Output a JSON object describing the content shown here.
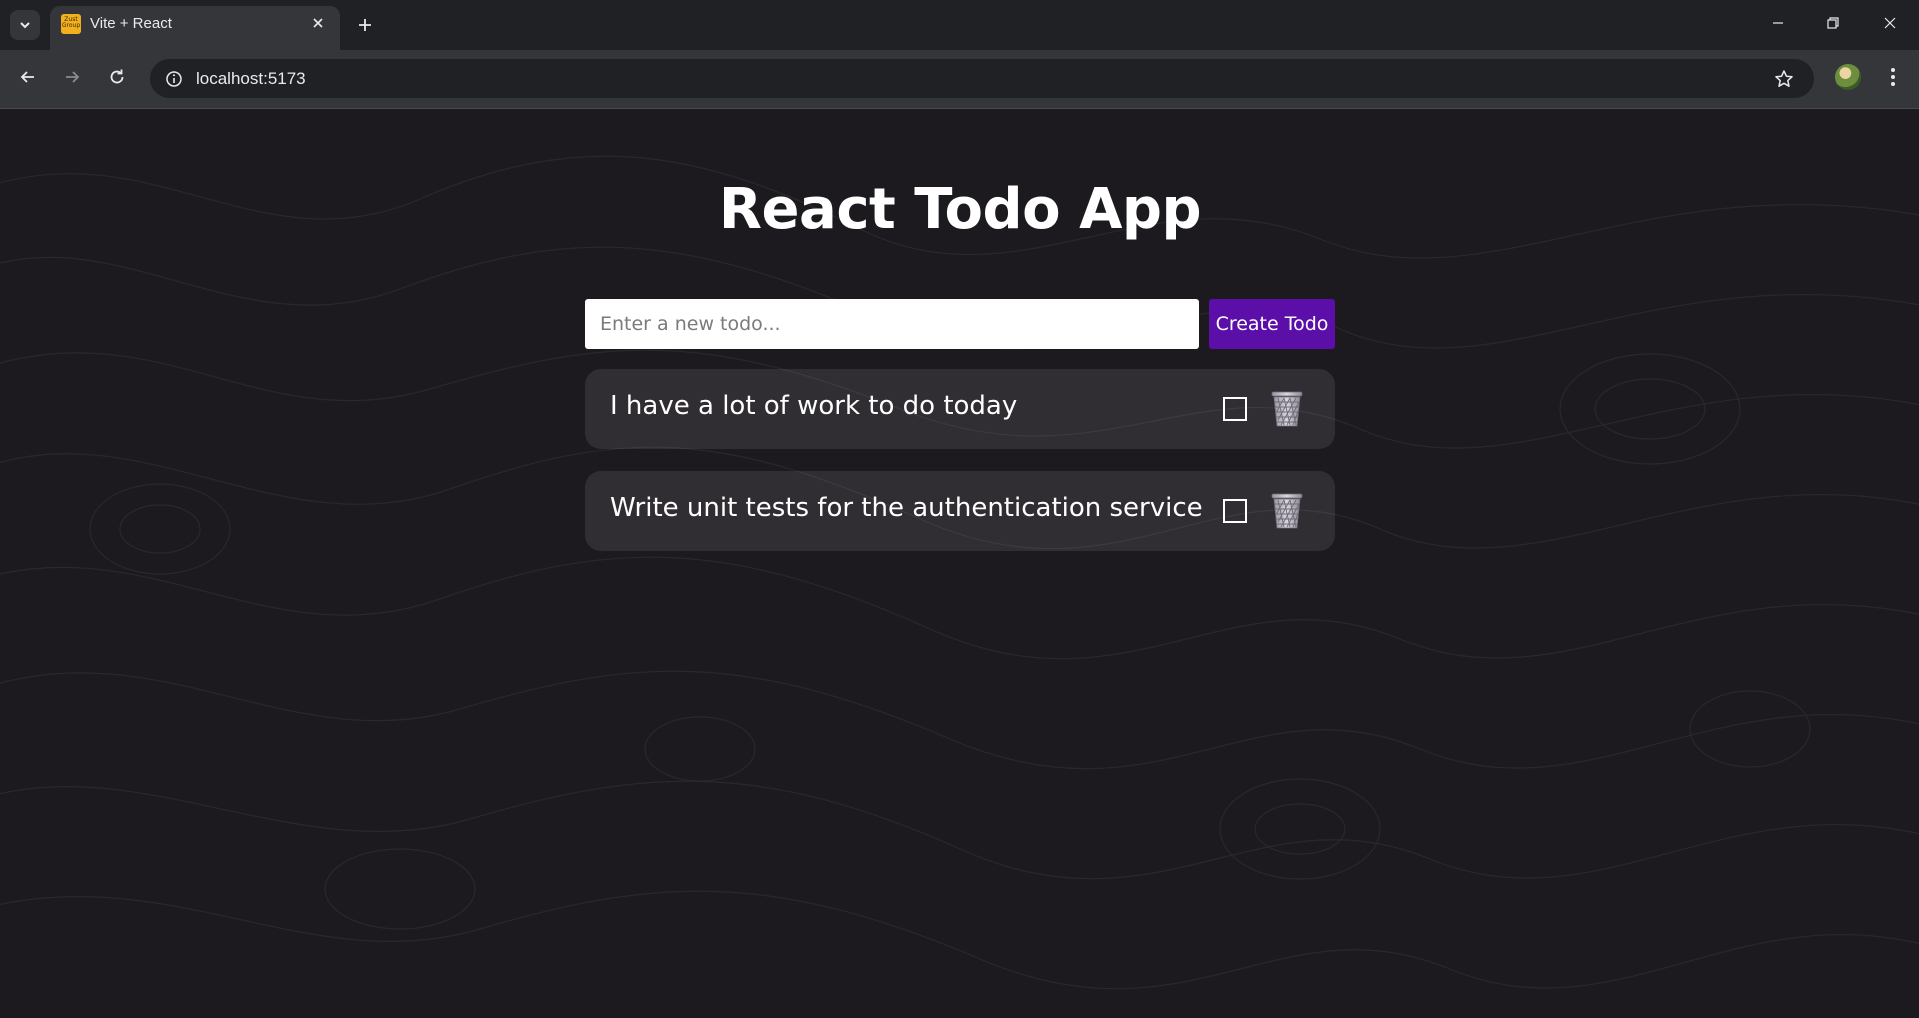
{
  "browser": {
    "tab_title": "Vite + React",
    "favicon_text": "Zust Group",
    "url": "localhost:5173",
    "icons": {
      "tab_search": "chevron-down-icon",
      "tab_close": "close-icon",
      "new_tab": "plus-icon",
      "back": "arrow-left-icon",
      "forward": "arrow-right-icon",
      "reload": "reload-icon",
      "site_info": "info-icon",
      "bookmark": "star-icon",
      "menu": "kebab-menu-icon"
    }
  },
  "app": {
    "title": "React Todo App",
    "input_placeholder": "Enter a new todo...",
    "input_value": "",
    "create_button_label": "Create Todo",
    "accent_color": "#5b0fa8",
    "todos": [
      {
        "text": "I have a lot of work to do today",
        "completed": false
      },
      {
        "text": "Write unit tests for the authentication service",
        "completed": false
      }
    ]
  }
}
